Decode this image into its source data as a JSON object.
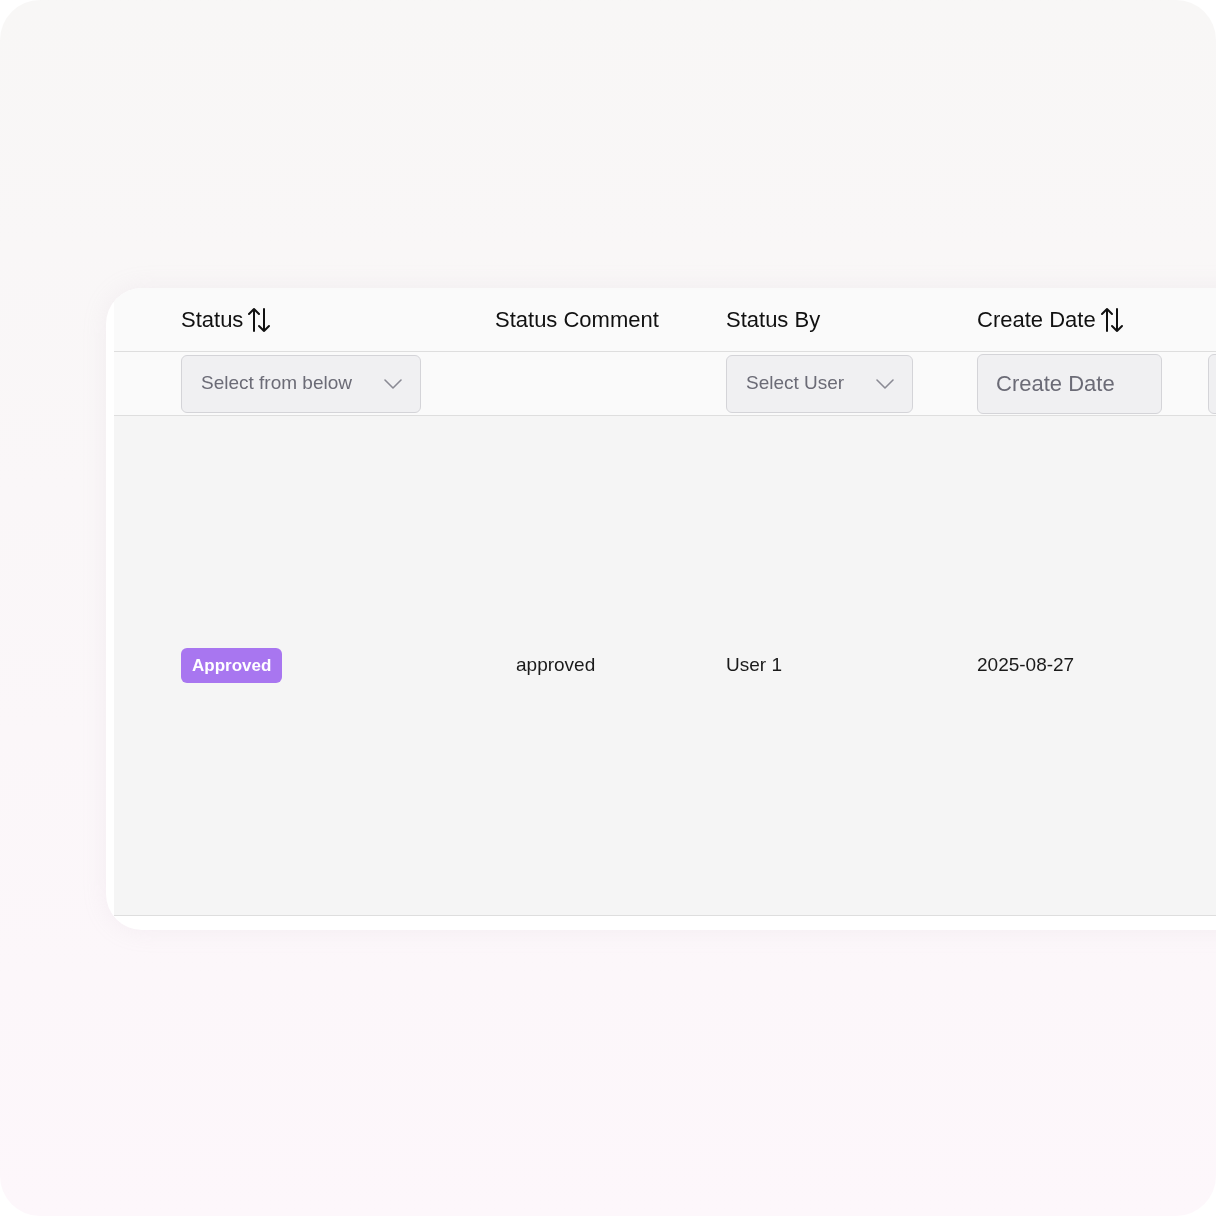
{
  "table": {
    "columns": [
      {
        "header": "Status",
        "sortable": true,
        "filter": {
          "kind": "select",
          "placeholder": "Select from below"
        }
      },
      {
        "header": "Status Comment",
        "sortable": false,
        "filter": {
          "kind": "none"
        }
      },
      {
        "header": "Status By",
        "sortable": false,
        "filter": {
          "kind": "select",
          "placeholder": "Select User"
        }
      },
      {
        "header": "Create Date",
        "sortable": true,
        "filter": {
          "kind": "input",
          "placeholder": "Create Date"
        }
      },
      {
        "filter": {
          "kind": "input"
        }
      }
    ],
    "rows": [
      {
        "cells": [
          {
            "kind": "badge",
            "text": "Approved"
          },
          {
            "kind": "text",
            "text": "approved"
          },
          {
            "kind": "text",
            "text": "User 1"
          },
          {
            "kind": "text",
            "text": "2025-08-27"
          }
        ]
      }
    ]
  }
}
